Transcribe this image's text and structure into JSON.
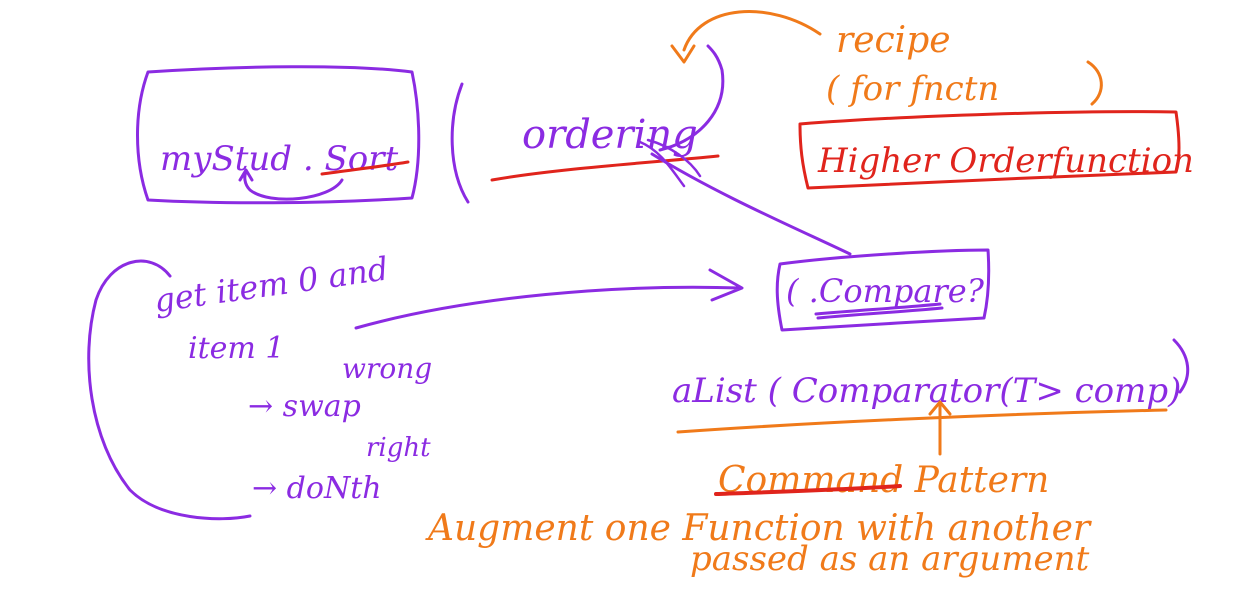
{
  "colors": {
    "purple": "#8b2be2",
    "orange": "#f07a1a",
    "red": "#e0241c",
    "background": "#ffffff"
  },
  "notes": {
    "my_student_sort": "myStud . Sort",
    "ordering": "ordering",
    "recipe": "recipe",
    "for_function": "( for fnctn",
    "higher_order_function": "Higher Orderfunction",
    "get_item_line1": "get item 0 and",
    "get_item_line2": "item 1",
    "wrong": "wrong",
    "swap": "→ swap",
    "right": "right",
    "do_nothing": "→ doNth",
    "compare": "( .Compare?",
    "a_list_comparator": "aList ( Comparator(T> comp)",
    "command_pattern": "Command Pattern",
    "augment_line": "Augment one Function with another",
    "passed_line": "passed as an argument"
  }
}
